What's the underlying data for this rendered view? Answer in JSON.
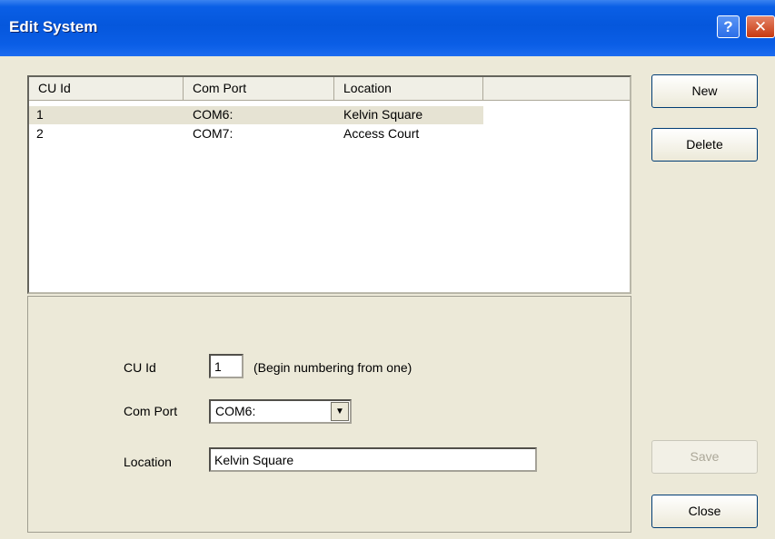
{
  "window": {
    "title": "Edit System",
    "help_label": "?",
    "close_label": "✕"
  },
  "list": {
    "columns": [
      "CU Id",
      "Com Port",
      "Location",
      ""
    ],
    "rows": [
      {
        "cu_id": "1",
        "com_port": "COM6:",
        "location": "Kelvin Square"
      },
      {
        "cu_id": "2",
        "com_port": "COM7:",
        "location": "Access Court"
      }
    ],
    "selected_index": 0
  },
  "form": {
    "cu_id_label": "CU Id",
    "cu_id_value": "1",
    "cu_id_hint": "(Begin numbering from one)",
    "com_port_label": "Com Port",
    "com_port_value": "COM6:",
    "location_label": "Location",
    "location_value": "Kelvin Square"
  },
  "buttons": {
    "new": "New",
    "delete": "Delete",
    "save": "Save",
    "close": "Close"
  },
  "icons": {
    "help": "question-mark-icon",
    "close": "close-x-icon",
    "dropdown": "chevron-down-icon"
  }
}
